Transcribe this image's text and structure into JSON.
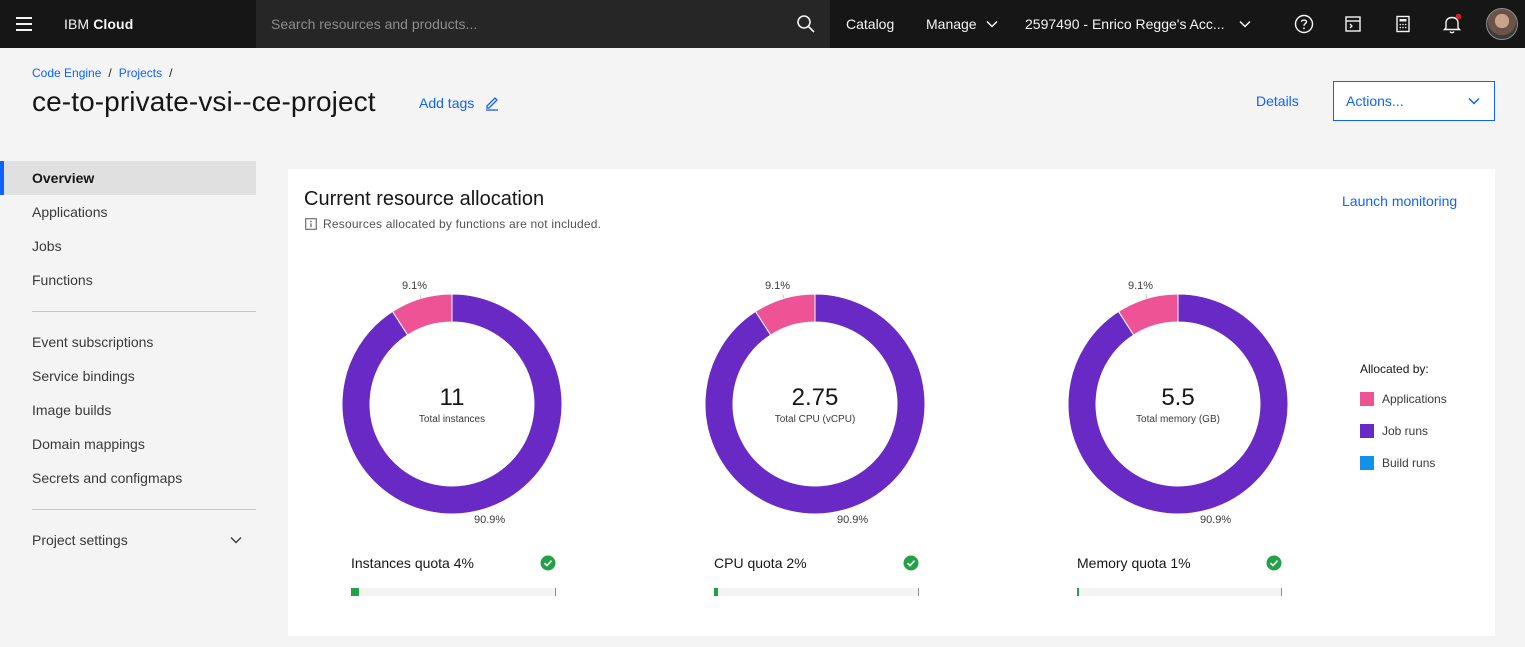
{
  "header": {
    "brand_prefix": "IBM",
    "brand_name": "Cloud",
    "search_placeholder": "Search resources and products...",
    "catalog": "Catalog",
    "manage": "Manage",
    "account": "2597490 - Enrico Regge's Acc..."
  },
  "breadcrumb": {
    "item1": "Code Engine",
    "sep1": "/",
    "item2": "Projects",
    "sep2": "/"
  },
  "page": {
    "title": "ce-to-private-vsi--ce-project",
    "add_tags": "Add tags",
    "details": "Details",
    "actions": "Actions..."
  },
  "sidenav": {
    "items": [
      "Overview",
      "Applications",
      "Jobs",
      "Functions"
    ],
    "items2": [
      "Event subscriptions",
      "Service bindings",
      "Image builds",
      "Domain mappings",
      "Secrets and configmaps"
    ],
    "settings": "Project settings"
  },
  "card": {
    "title": "Current resource allocation",
    "note": "Resources allocated by functions are not included.",
    "launch": "Launch monitoring"
  },
  "colors": {
    "applications": "#ee5396",
    "job_runs": "#6929c4",
    "build_runs": "#1192e8",
    "quota_ok": "#24a148",
    "link": "#0f62fe"
  },
  "chart_data": [
    {
      "type": "pie",
      "center_value": "11",
      "center_label": "Total instances",
      "slices": [
        {
          "name": "Applications",
          "value": 9.1,
          "label": "9.1%"
        },
        {
          "name": "Job runs",
          "value": 90.9,
          "label": "90.9%"
        }
      ]
    },
    {
      "type": "pie",
      "center_value": "2.75",
      "center_label": "Total CPU (vCPU)",
      "slices": [
        {
          "name": "Applications",
          "value": 9.1,
          "label": "9.1%"
        },
        {
          "name": "Job runs",
          "value": 90.9,
          "label": "90.9%"
        }
      ]
    },
    {
      "type": "pie",
      "center_value": "5.5",
      "center_label": "Total memory (GB)",
      "slices": [
        {
          "name": "Applications",
          "value": 9.1,
          "label": "9.1%"
        },
        {
          "name": "Job runs",
          "value": 90.9,
          "label": "90.9%"
        }
      ]
    }
  ],
  "quotas": [
    {
      "label": "Instances quota",
      "percent_text": "4%",
      "percent": 4
    },
    {
      "label": "CPU quota",
      "percent_text": "2%",
      "percent": 2
    },
    {
      "label": "Memory quota",
      "percent_text": "1%",
      "percent": 1
    }
  ],
  "legend": {
    "title": "Allocated by:",
    "items": [
      "Applications",
      "Job runs",
      "Build runs"
    ]
  }
}
